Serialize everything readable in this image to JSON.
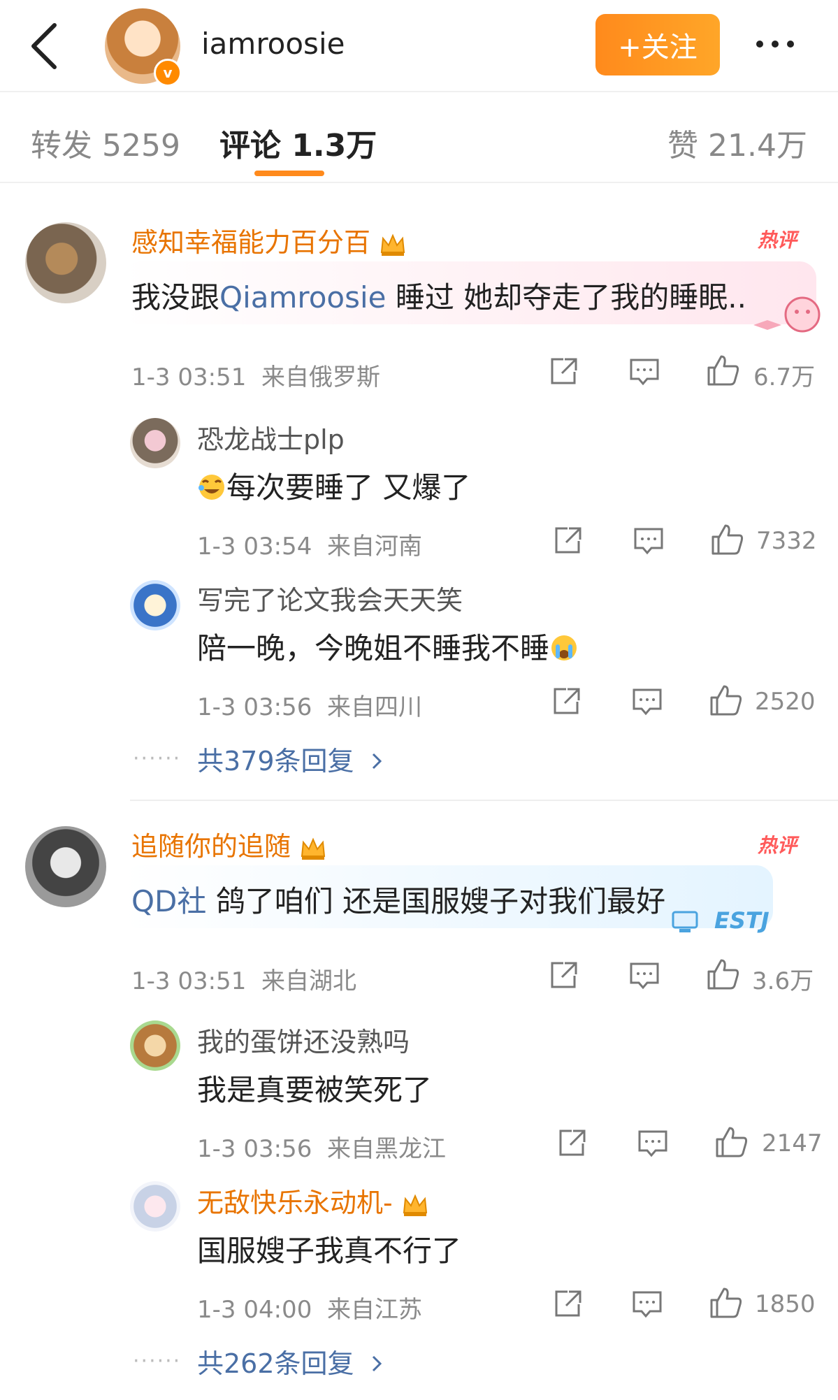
{
  "header": {
    "username": "iamroosie",
    "follow_label": "+关注"
  },
  "tabs": {
    "repost": "转发 5259",
    "comment": "评论 1.3万",
    "like": "赞 21.4万"
  },
  "hot_label": "热评",
  "comments": [
    {
      "author": "感知幸福能力百分百",
      "content_pre": "我没跟",
      "mention": "Qiamroosie",
      "content_post": " 睡过 她却夺走了我的睡眠..",
      "time": "1-3 03:51",
      "location": "来自俄罗斯",
      "likes": "6.7万",
      "replies": [
        {
          "author": "恐龙战士plp",
          "content": "每次要睡了 又爆了",
          "time": "1-3 03:54",
          "location": "来自河南",
          "likes": "7332"
        },
        {
          "author": "写完了论文我会天天笑",
          "content": "陪一晚，今晚姐不睡我不睡",
          "time": "1-3 03:56",
          "location": "来自四川",
          "likes": "2520"
        }
      ],
      "replies_link": "共379条回复"
    },
    {
      "author": "追随你的追随",
      "mention": "QD社",
      "content_post": " 鸽了咱们 还是国服嫂子对我们最好",
      "bubble_decor": "ESTJ",
      "time": "1-3 03:51",
      "location": "来自湖北",
      "likes": "3.6万",
      "replies": [
        {
          "author": "我的蛋饼还没熟吗",
          "content": "我是真要被笑死了",
          "time": "1-3 03:56",
          "location": "来自黑龙江",
          "likes": "2147"
        },
        {
          "author": "无敌快乐永动机-",
          "content": "国服嫂子我真不行了",
          "time": "1-3 04:00",
          "location": "来自江苏",
          "likes": "1850"
        }
      ],
      "replies_link": "共262条回复"
    }
  ],
  "colors": {
    "accent": "#ff8a1c",
    "vip_name": "#e87400",
    "link": "#4a6fa5",
    "meta": "#8a8a8a",
    "hot": "#ff5a5a"
  },
  "icons": [
    "back-arrow-icon",
    "verified-icon",
    "more-icon",
    "crown-icon",
    "repost-icon",
    "comment-icon",
    "like-icon",
    "chevron-right-icon",
    "laugh-cry-emoji-icon",
    "crying-emoji-icon"
  ]
}
